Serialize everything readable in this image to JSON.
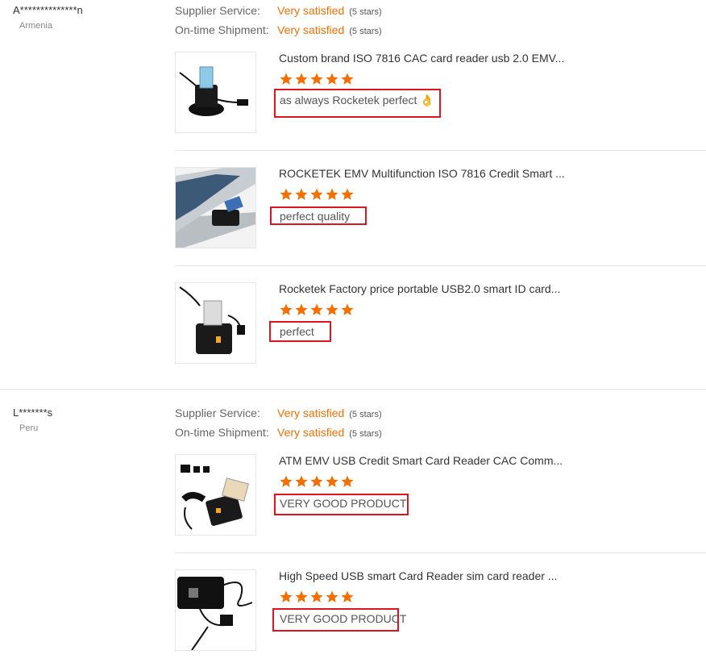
{
  "feedback": [
    {
      "buyer": "A**************n",
      "country": "Armenia",
      "supplier_service_label": "Supplier Service:",
      "supplier_service_value": "Very satisfied",
      "supplier_service_stars": "(5 stars)",
      "shipment_label": "On-time Shipment:",
      "shipment_value": "Very satisfied",
      "shipment_stars": "(5 stars)",
      "items": [
        {
          "title": "Custom brand ISO 7816 CAC card reader usb 2.0 EMV...",
          "rating": 5,
          "comment": "as always Rocketek perfect 👌",
          "thumb_icon": "card-reader-icon"
        },
        {
          "title": "ROCKETEK EMV Multifunction ISO 7816 Credit Smart ...",
          "rating": 5,
          "comment": "perfect quality",
          "thumb_icon": "laptop-card-reader-icon"
        },
        {
          "title": "Rocketek Factory price portable USB2.0 smart ID card...",
          "rating": 5,
          "comment": "perfect",
          "thumb_icon": "card-reader-icon"
        }
      ]
    },
    {
      "buyer": "L*******s",
      "country": "Peru",
      "supplier_service_label": "Supplier Service:",
      "supplier_service_value": "Very satisfied",
      "supplier_service_stars": "(5 stars)",
      "shipment_label": "On-time Shipment:",
      "shipment_value": "Very satisfied",
      "shipment_stars": "(5 stars)",
      "items": [
        {
          "title": "ATM EMV USB Credit Smart Card Reader CAC Comm...",
          "rating": 5,
          "comment": "VERY GOOD PRODUCT",
          "thumb_icon": "card-reader-icon"
        },
        {
          "title": "High Speed USB smart Card Reader sim card reader ...",
          "rating": 5,
          "comment": "VERY GOOD PRODUCT",
          "thumb_icon": "card-reader-icon"
        }
      ]
    }
  ],
  "colors": {
    "accent": "#f56f00",
    "highlight": "#e0141e",
    "star": "#f56f00"
  }
}
